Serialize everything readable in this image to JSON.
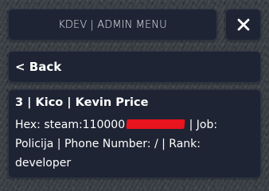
{
  "header": {
    "title": "KDEV | ADMIN MENU",
    "close_label": "×"
  },
  "nav": {
    "back_label": "< Back"
  },
  "player": {
    "heading": "3 | Kico | Kevin Price",
    "hex_prefix": "Hex: steam:11000",
    "hex_suffix": "0",
    "details_rest": " | Job: Policija | Phone Number: / | Rank: developer"
  },
  "colors": {
    "panel_bg": "#1e2433",
    "text": "#ffffff",
    "redaction": "#e8141e"
  }
}
